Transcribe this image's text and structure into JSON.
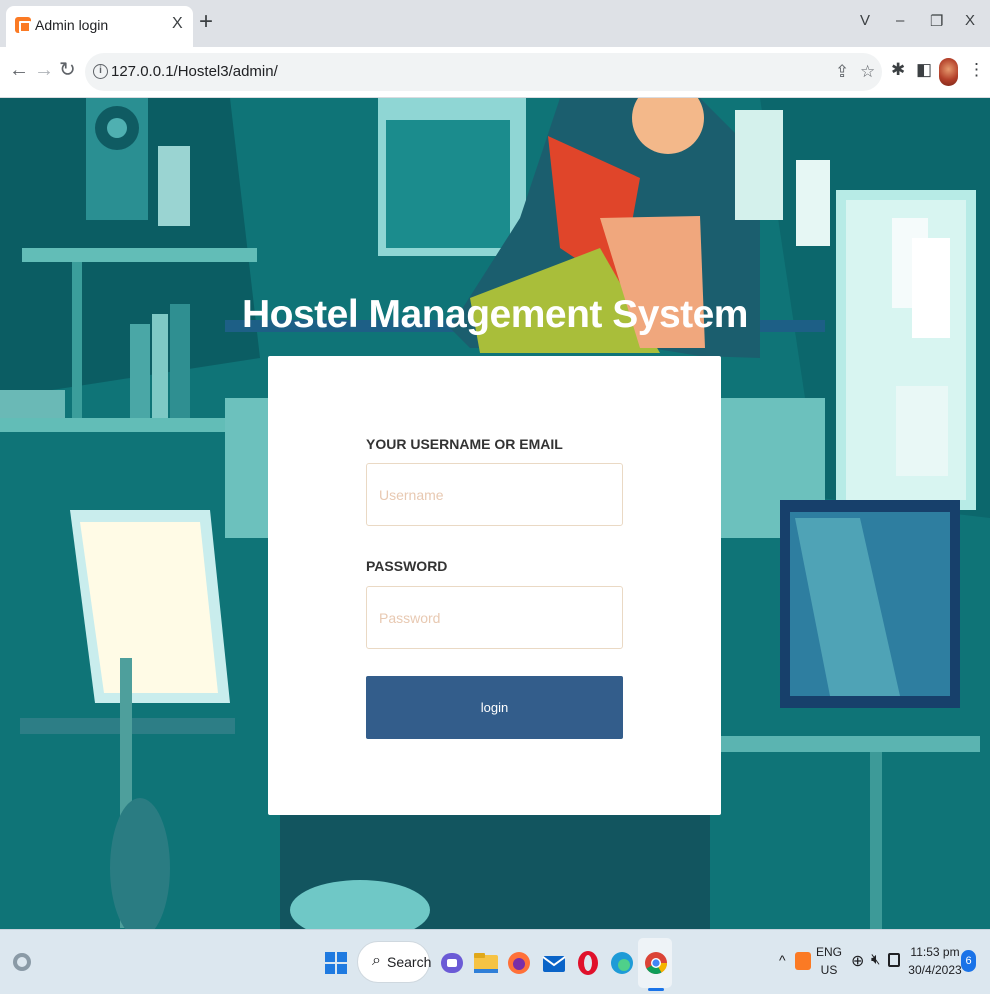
{
  "browser": {
    "tab_title": "Admin login",
    "tab_close": "X",
    "new_tab": "+",
    "window_controls": {
      "dropdown": "V",
      "minimize": "–",
      "restore": "❐",
      "close": "X"
    },
    "url": "127.0.0.1/Hostel3/admin/"
  },
  "page": {
    "heading": "Hostel Management System",
    "form": {
      "username_label": "YOUR USERNAME OR EMAIL",
      "username_placeholder": "Username",
      "username_value": "",
      "password_label": "PASSWORD",
      "password_placeholder": "Password",
      "password_value": "",
      "login_label": "login"
    },
    "colors": {
      "button": "#335d8b",
      "heading": "#ffffff"
    }
  },
  "taskbar": {
    "search_label": "Search",
    "lang_line1": "ENG",
    "lang_line2": "US",
    "time": "11:53 pm",
    "date": "30/4/2023",
    "notification_count": "6",
    "apps": [
      "windows-start",
      "search",
      "meet",
      "file-explorer",
      "firefox",
      "mail",
      "opera",
      "edge",
      "chrome"
    ]
  }
}
